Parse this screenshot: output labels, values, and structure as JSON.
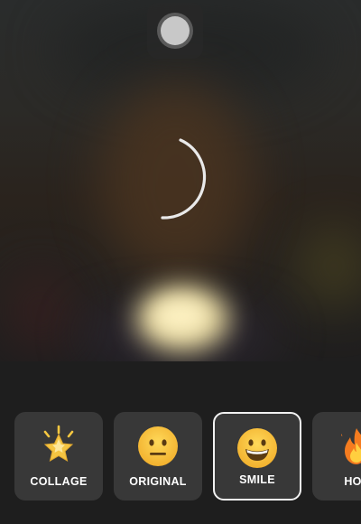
{
  "camera": {
    "capture_button_icon": "shutter-icon",
    "loading_indicator_icon": "spinner-icon"
  },
  "filters": [
    {
      "label": "COLLAGE",
      "icon": "glowing-star-emoji",
      "selected": false
    },
    {
      "label": "ORIGINAL",
      "icon": "neutral-face-emoji",
      "selected": false
    },
    {
      "label": "SMILE",
      "icon": "grinning-face-emoji",
      "selected": true
    },
    {
      "label": "HOT",
      "icon": "fire-emoji",
      "selected": false
    }
  ],
  "colors": {
    "card_background": "#383838",
    "selected_border": "#f2f2f2",
    "strip_background": "#1e1e1e",
    "emoji_yellow": "#f7c841"
  }
}
